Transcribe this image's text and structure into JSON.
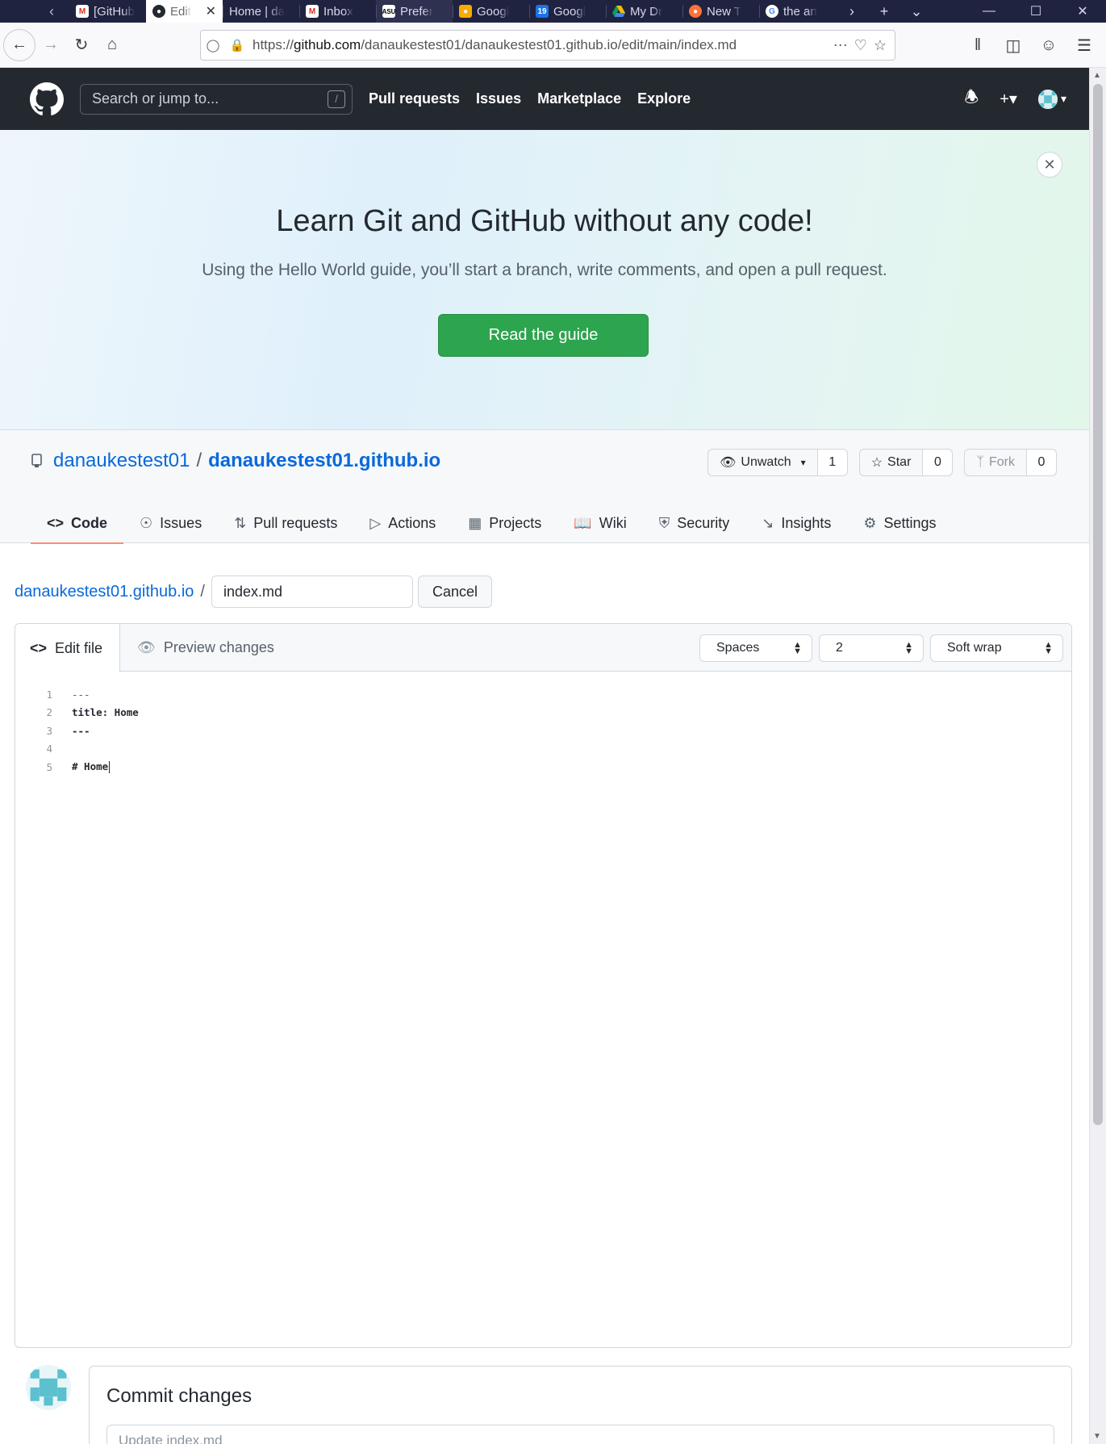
{
  "browser": {
    "tabs": [
      {
        "label": "[GitHub",
        "icon": "gmail-icon",
        "color": "#d93025"
      },
      {
        "label": "Edit",
        "icon": "github-icon",
        "color": "#24292f",
        "active": true
      },
      {
        "label": "Home | da",
        "icon": "",
        "color": ""
      },
      {
        "label": "Inbox",
        "icon": "gmail-icon",
        "color": "#d93025"
      },
      {
        "label": "Prefer",
        "icon": "asu-icon",
        "color": "#8c1d40"
      },
      {
        "label": "Googl",
        "icon": "keep-icon",
        "color": "#f9ab00"
      },
      {
        "label": "Googl",
        "icon": "calendar-icon",
        "color": "#1a73e8"
      },
      {
        "label": "My Dr",
        "icon": "drive-icon",
        "color": "#0f9d58"
      },
      {
        "label": "New T",
        "icon": "firefox-icon",
        "color": "#ff7139"
      },
      {
        "label": "the an",
        "icon": "google-icon",
        "color": "#4285f4"
      }
    ],
    "url_prefix": "https://",
    "url_domain": "github.com",
    "url_path": "/danaukestest01/danaukestest01.github.io/edit/main/index.md"
  },
  "github": {
    "search_placeholder": "Search or jump to...",
    "search_shortcut": "/",
    "nav": [
      "Pull requests",
      "Issues",
      "Marketplace",
      "Explore"
    ]
  },
  "banner": {
    "title": "Learn Git and GitHub without any code!",
    "subtitle": "Using the Hello World guide, you’ll start a branch, write comments, and open a pull request.",
    "button": "Read the guide"
  },
  "repo": {
    "owner": "danaukestest01",
    "separator": "/",
    "name": "danaukestest01.github.io",
    "watch_label": "Unwatch",
    "watch_count": "1",
    "star_label": "Star",
    "star_count": "0",
    "fork_label": "Fork",
    "fork_count": "0",
    "tabs": [
      "Code",
      "Issues",
      "Pull requests",
      "Actions",
      "Projects",
      "Wiki",
      "Security",
      "Insights",
      "Settings"
    ]
  },
  "editor": {
    "breadcrumb": "danaukestest01.github.io",
    "breadcrumb_sep": "/",
    "filename": "index.md",
    "cancel_label": "Cancel",
    "edit_tab": "Edit file",
    "preview_tab": "Preview changes",
    "indent_mode": "Spaces",
    "indent_size": "2",
    "wrap_mode": "Soft wrap",
    "lines": [
      {
        "num": "1",
        "text": "---"
      },
      {
        "num": "2",
        "text": "title: Home"
      },
      {
        "num": "3",
        "text": "---"
      },
      {
        "num": "4",
        "text": ""
      },
      {
        "num": "5",
        "text": "# Home"
      }
    ]
  },
  "commit": {
    "title": "Commit changes",
    "placeholder": "Update index.md"
  }
}
